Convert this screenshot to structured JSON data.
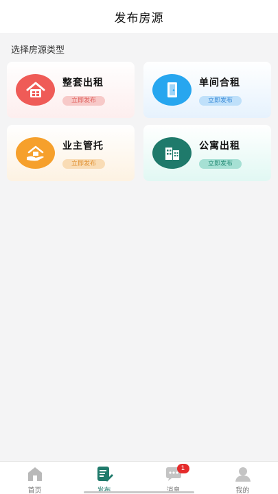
{
  "header": {
    "title": "发布房源"
  },
  "section": {
    "label": "选择房源类型"
  },
  "cards": [
    {
      "title": "整套出租",
      "badge": "立即发布",
      "icon": "house-icon",
      "color": "#ef5b57"
    },
    {
      "title": "单间合租",
      "badge": "立即发布",
      "icon": "door-icon",
      "color": "#27a6ef"
    },
    {
      "title": "业主管托",
      "badge": "立即发布",
      "icon": "hand-house-icon",
      "color": "#f6a02c"
    },
    {
      "title": "公寓出租",
      "badge": "立即发布",
      "icon": "building-icon",
      "color": "#1f7a6b"
    }
  ],
  "tabbar": {
    "items": [
      {
        "label": "首页",
        "icon": "home-icon",
        "active": false
      },
      {
        "label": "发布",
        "icon": "publish-icon",
        "active": true
      },
      {
        "label": "消息",
        "icon": "chat-icon",
        "active": false,
        "badge": "1"
      },
      {
        "label": "我的",
        "icon": "user-icon",
        "active": false
      }
    ]
  }
}
